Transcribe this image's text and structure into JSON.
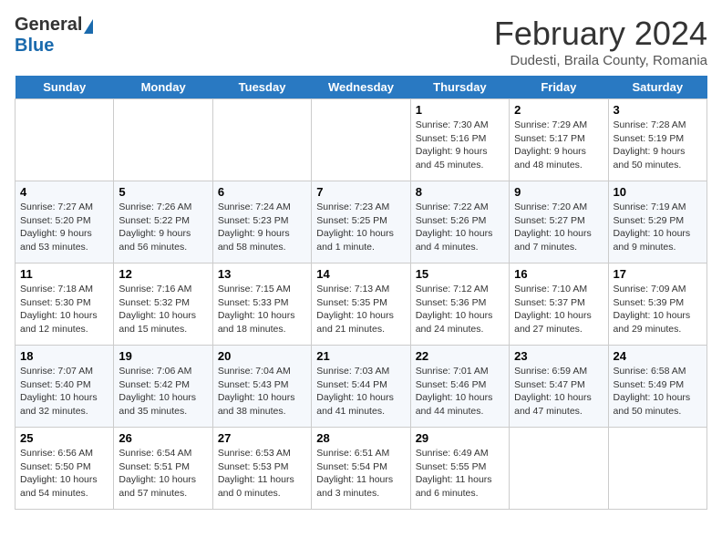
{
  "header": {
    "logo_general": "General",
    "logo_blue": "Blue",
    "month_title": "February 2024",
    "location": "Dudesti, Braila County, Romania"
  },
  "days_of_week": [
    "Sunday",
    "Monday",
    "Tuesday",
    "Wednesday",
    "Thursday",
    "Friday",
    "Saturday"
  ],
  "weeks": [
    {
      "days": [
        {
          "num": "",
          "info": "",
          "empty": true
        },
        {
          "num": "",
          "info": "",
          "empty": true
        },
        {
          "num": "",
          "info": "",
          "empty": true
        },
        {
          "num": "",
          "info": "",
          "empty": true
        },
        {
          "num": "1",
          "info": "Sunrise: 7:30 AM\nSunset: 5:16 PM\nDaylight: 9 hours\nand 45 minutes.",
          "empty": false
        },
        {
          "num": "2",
          "info": "Sunrise: 7:29 AM\nSunset: 5:17 PM\nDaylight: 9 hours\nand 48 minutes.",
          "empty": false
        },
        {
          "num": "3",
          "info": "Sunrise: 7:28 AM\nSunset: 5:19 PM\nDaylight: 9 hours\nand 50 minutes.",
          "empty": false
        }
      ]
    },
    {
      "days": [
        {
          "num": "4",
          "info": "Sunrise: 7:27 AM\nSunset: 5:20 PM\nDaylight: 9 hours\nand 53 minutes.",
          "empty": false
        },
        {
          "num": "5",
          "info": "Sunrise: 7:26 AM\nSunset: 5:22 PM\nDaylight: 9 hours\nand 56 minutes.",
          "empty": false
        },
        {
          "num": "6",
          "info": "Sunrise: 7:24 AM\nSunset: 5:23 PM\nDaylight: 9 hours\nand 58 minutes.",
          "empty": false
        },
        {
          "num": "7",
          "info": "Sunrise: 7:23 AM\nSunset: 5:25 PM\nDaylight: 10 hours\nand 1 minute.",
          "empty": false
        },
        {
          "num": "8",
          "info": "Sunrise: 7:22 AM\nSunset: 5:26 PM\nDaylight: 10 hours\nand 4 minutes.",
          "empty": false
        },
        {
          "num": "9",
          "info": "Sunrise: 7:20 AM\nSunset: 5:27 PM\nDaylight: 10 hours\nand 7 minutes.",
          "empty": false
        },
        {
          "num": "10",
          "info": "Sunrise: 7:19 AM\nSunset: 5:29 PM\nDaylight: 10 hours\nand 9 minutes.",
          "empty": false
        }
      ]
    },
    {
      "days": [
        {
          "num": "11",
          "info": "Sunrise: 7:18 AM\nSunset: 5:30 PM\nDaylight: 10 hours\nand 12 minutes.",
          "empty": false
        },
        {
          "num": "12",
          "info": "Sunrise: 7:16 AM\nSunset: 5:32 PM\nDaylight: 10 hours\nand 15 minutes.",
          "empty": false
        },
        {
          "num": "13",
          "info": "Sunrise: 7:15 AM\nSunset: 5:33 PM\nDaylight: 10 hours\nand 18 minutes.",
          "empty": false
        },
        {
          "num": "14",
          "info": "Sunrise: 7:13 AM\nSunset: 5:35 PM\nDaylight: 10 hours\nand 21 minutes.",
          "empty": false
        },
        {
          "num": "15",
          "info": "Sunrise: 7:12 AM\nSunset: 5:36 PM\nDaylight: 10 hours\nand 24 minutes.",
          "empty": false
        },
        {
          "num": "16",
          "info": "Sunrise: 7:10 AM\nSunset: 5:37 PM\nDaylight: 10 hours\nand 27 minutes.",
          "empty": false
        },
        {
          "num": "17",
          "info": "Sunrise: 7:09 AM\nSunset: 5:39 PM\nDaylight: 10 hours\nand 29 minutes.",
          "empty": false
        }
      ]
    },
    {
      "days": [
        {
          "num": "18",
          "info": "Sunrise: 7:07 AM\nSunset: 5:40 PM\nDaylight: 10 hours\nand 32 minutes.",
          "empty": false
        },
        {
          "num": "19",
          "info": "Sunrise: 7:06 AM\nSunset: 5:42 PM\nDaylight: 10 hours\nand 35 minutes.",
          "empty": false
        },
        {
          "num": "20",
          "info": "Sunrise: 7:04 AM\nSunset: 5:43 PM\nDaylight: 10 hours\nand 38 minutes.",
          "empty": false
        },
        {
          "num": "21",
          "info": "Sunrise: 7:03 AM\nSunset: 5:44 PM\nDaylight: 10 hours\nand 41 minutes.",
          "empty": false
        },
        {
          "num": "22",
          "info": "Sunrise: 7:01 AM\nSunset: 5:46 PM\nDaylight: 10 hours\nand 44 minutes.",
          "empty": false
        },
        {
          "num": "23",
          "info": "Sunrise: 6:59 AM\nSunset: 5:47 PM\nDaylight: 10 hours\nand 47 minutes.",
          "empty": false
        },
        {
          "num": "24",
          "info": "Sunrise: 6:58 AM\nSunset: 5:49 PM\nDaylight: 10 hours\nand 50 minutes.",
          "empty": false
        }
      ]
    },
    {
      "days": [
        {
          "num": "25",
          "info": "Sunrise: 6:56 AM\nSunset: 5:50 PM\nDaylight: 10 hours\nand 54 minutes.",
          "empty": false
        },
        {
          "num": "26",
          "info": "Sunrise: 6:54 AM\nSunset: 5:51 PM\nDaylight: 10 hours\nand 57 minutes.",
          "empty": false
        },
        {
          "num": "27",
          "info": "Sunrise: 6:53 AM\nSunset: 5:53 PM\nDaylight: 11 hours\nand 0 minutes.",
          "empty": false
        },
        {
          "num": "28",
          "info": "Sunrise: 6:51 AM\nSunset: 5:54 PM\nDaylight: 11 hours\nand 3 minutes.",
          "empty": false
        },
        {
          "num": "29",
          "info": "Sunrise: 6:49 AM\nSunset: 5:55 PM\nDaylight: 11 hours\nand 6 minutes.",
          "empty": false
        },
        {
          "num": "",
          "info": "",
          "empty": true
        },
        {
          "num": "",
          "info": "",
          "empty": true
        }
      ]
    }
  ]
}
